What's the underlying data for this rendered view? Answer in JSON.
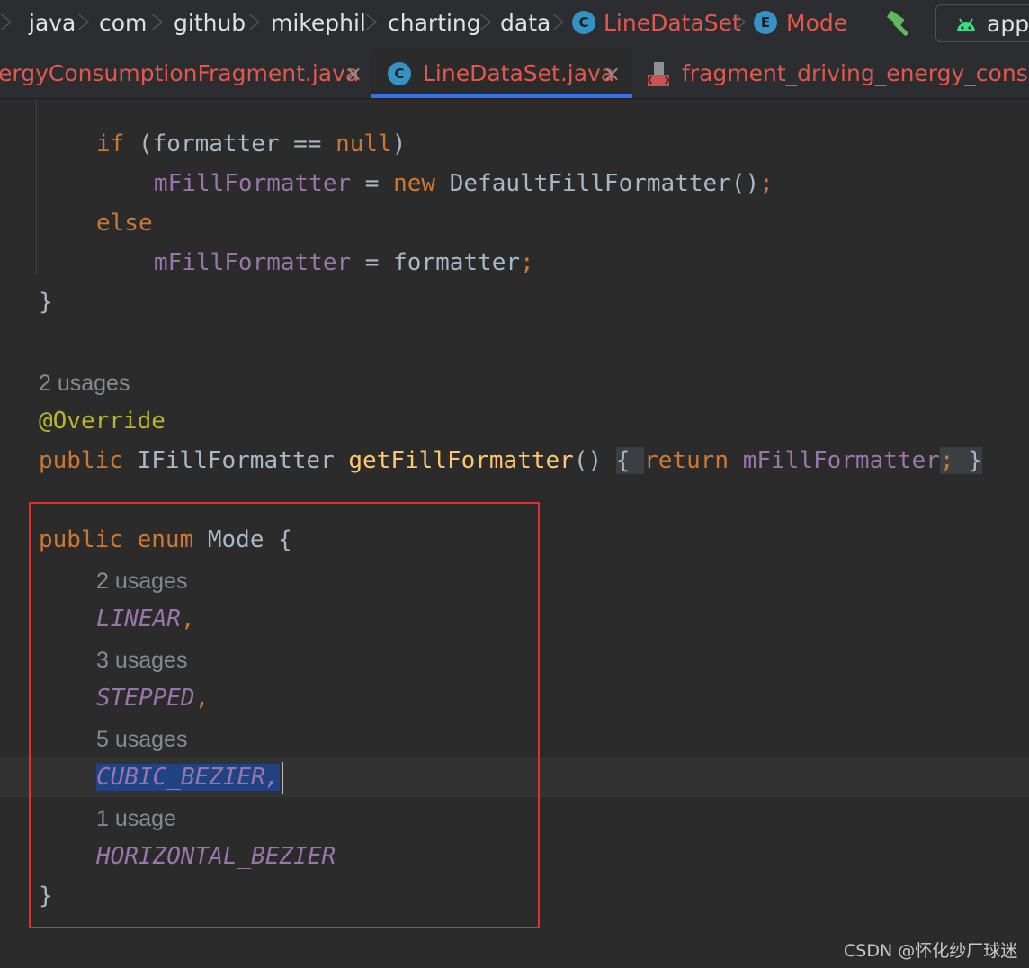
{
  "breadcrumb": {
    "items": [
      "java",
      "com",
      "github",
      "mikephil",
      "charting",
      "data",
      "LineDataSet",
      "Mode"
    ],
    "class_icon_letter": "C",
    "enum_icon_letter": "E"
  },
  "toolbar": {
    "run_config_label": "app"
  },
  "tabs": [
    {
      "label": "ergyConsumptionFragment.java",
      "close": "×"
    },
    {
      "label": "LineDataSet.java",
      "close": "×",
      "icon_letter": "C"
    },
    {
      "label": "fragment_driving_energy_consupt"
    }
  ],
  "code": {
    "l1": {
      "if": "if",
      "rest": " (formatter == ",
      "null": "null",
      "end": ")"
    },
    "l2": {
      "field": "mFillFormatter",
      "eq": " = ",
      "new": "new",
      "cls": " DefaultFillFormatter()",
      "semi": ";"
    },
    "l3": {
      "else": "else"
    },
    "l4": {
      "field": "mFillFormatter",
      "rest": " = formatter",
      "semi": ";"
    },
    "l5": {
      "brace": "}"
    },
    "hint1": "2 usages",
    "l6": {
      "ann": "@Override"
    },
    "l7": {
      "public": "public",
      "type": " IFillFormatter ",
      "fn": "getFillFormatter",
      "parens": "()",
      "sp": " ",
      "ob": "{ ",
      "ret": "return",
      "sp2": " ",
      "field": "mFillFormatter",
      "semi": ";",
      "cb": " }"
    },
    "l8": {
      "public": "public",
      "enum": "enum",
      "name": " Mode {"
    },
    "hint2": "2 usages",
    "c1": {
      "name": "LINEAR",
      "comma": ","
    },
    "hint3": "3 usages",
    "c2": {
      "name": "STEPPED",
      "comma": ","
    },
    "hint4": "5 usages",
    "c3": {
      "name": "CUBIC_BEZIER,",
      "comma": ""
    },
    "hint5": "1 usage",
    "c4": {
      "name": "HORIZONTAL_BEZIER"
    },
    "l9": {
      "brace": "}"
    }
  },
  "watermark": "CSDN @怀化纱厂球迷",
  "colors": {
    "keyword": "#cc7832",
    "field": "#9876aa",
    "function": "#ffc66d",
    "annotation": "#bbb529",
    "tab_label": "#e0594f",
    "highlight_box": "#e02f2f",
    "selection": "#214283"
  }
}
